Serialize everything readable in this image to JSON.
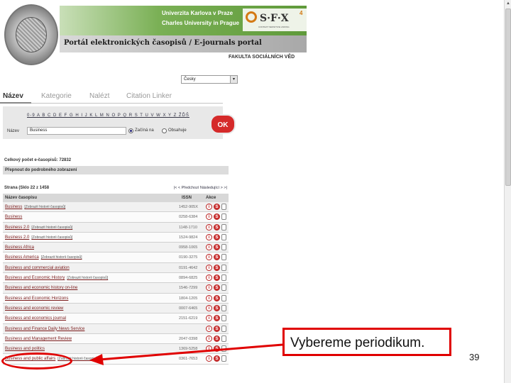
{
  "header": {
    "university_cz": "Univerzita Karlova v Praze",
    "university_en": "Charles University in Prague",
    "sfx_logo": "S·F·X",
    "sfx_sup": "4",
    "sfx_tagline": "CONTEXT SENSITIVE LINKING",
    "portal_title": "Portál elektronických časopisů / E-journals portal",
    "faculty": "FAKULTA SOCIÁLNÍCH VĚD"
  },
  "language_select": {
    "value": "Česky"
  },
  "tabs": [
    {
      "label": "Název",
      "active": true
    },
    {
      "label": "Kategorie",
      "active": false
    },
    {
      "label": "Nalézt",
      "active": false
    },
    {
      "label": "Citation Linker",
      "active": false
    }
  ],
  "search": {
    "alphabet": "0-9 A B C D E F G H I J K L M N O P Q R S T U V W X Y Z ŽĎŠ",
    "name_label": "Název",
    "name_value": "Business",
    "option_starts": "Začíná na",
    "option_contains": "Obsahuje",
    "selected_option": "starts",
    "ok_label": "OK"
  },
  "results": {
    "total": "Celkový počet e-časopisů: 72832",
    "switch_view": "Přepnout do podrobného zobrazení",
    "page_info": "Strana (Sklo 22 z 1458",
    "page_nav": "|<  < Předchozí  Následující >  >|",
    "columns": {
      "title": "Název časopisu",
      "issn": "ISSN",
      "actions": "Akce"
    },
    "rows": [
      {
        "title": "Business",
        "note": "[Zobrazit historii časopisů]",
        "issn": "1452-905X"
      },
      {
        "title": "Business",
        "note": "",
        "issn": "0258-6384"
      },
      {
        "title": "Business 2.0",
        "note": "[Zobrazit historii časopisů]",
        "issn": "1148-1710"
      },
      {
        "title": "Business 2.0",
        "note": "[Zobrazit historii časopisů]",
        "issn": "1524-9824"
      },
      {
        "title": "Business Africa",
        "note": "",
        "issn": "0958-1065"
      },
      {
        "title": "Business America",
        "note": "[Zobrazit historii časopisů]",
        "issn": "0190-3275"
      },
      {
        "title": "Business and commercial aviation",
        "note": "",
        "issn": "0191-4642"
      },
      {
        "title": "Business and Economic History",
        "note": "[Zobrazit historii časopisů]",
        "issn": "0894-6825"
      },
      {
        "title": "Business and economic history on-line",
        "note": "",
        "issn": "1546-7299"
      },
      {
        "title": "Business and Economic Horizons",
        "note": "",
        "issn": "1804-1205"
      },
      {
        "title": "Business and economic review",
        "note": "",
        "issn": "0007-6465"
      },
      {
        "title": "Business and economics journal",
        "note": "",
        "issn": "2151-6219"
      },
      {
        "title": "Business and Finance Daily News Service",
        "note": "",
        "issn": ""
      },
      {
        "title": "Business and Management Review",
        "note": "",
        "issn": "2047-0398"
      },
      {
        "title": "Business and politics",
        "note": "",
        "issn": "1369-5258"
      },
      {
        "title": "Business and public affairs",
        "note": "[Zobrazit historii časopisů]",
        "issn": "0361-7653"
      }
    ]
  },
  "annotation": {
    "callout_text": "Vybereme periodikum.",
    "color": "#e00000"
  },
  "slide_number": "39"
}
